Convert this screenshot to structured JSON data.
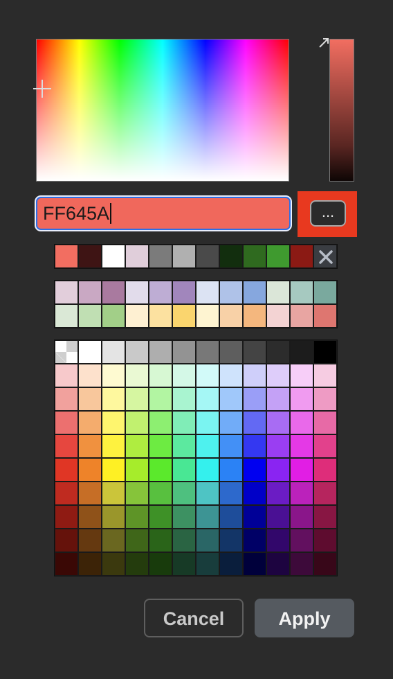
{
  "picker": {
    "hex_value": "FF645A",
    "more_label": "...",
    "selected_color": "#F26E61"
  },
  "recent_colors": [
    "#F26E61",
    "#3E1414",
    "#FFFFFF",
    "#E0CEDA",
    "#7B7B7B",
    "#B0B0B0",
    "#4A4A4A",
    "#122E0E",
    "#2F6A1F",
    "#3F9A2F",
    "#8B1A14",
    "clear"
  ],
  "pastel_rows": [
    [
      "#E2CEDB",
      "#C9A8C3",
      "#A97A9F",
      "#E2DCEB",
      "#BEADD4",
      "#A186BC",
      "#DCE3F3",
      "#AFC2E8",
      "#86A7DE",
      "#DBE6D8",
      "#A6C9C0",
      "#7AA99E"
    ],
    [
      "#DAE8D6",
      "#C0DFB3",
      "#A2CF88",
      "#FEF0D2",
      "#FCE1A0",
      "#FAD56E",
      "#FEF4D1",
      "#F8D1A7",
      "#F4B77E",
      "#F3D3D3",
      "#E8A5A2",
      "#DE7670"
    ]
  ],
  "main_rows": [
    [
      "transparent",
      "#FFFFFF",
      "#E4E4E4",
      "#C9C9C9",
      "#AEAEAE",
      "#939393",
      "#787878",
      "#5E5E5E",
      "#444444",
      "#2C2C2C",
      "#1C1C1C",
      "#000000"
    ],
    [
      "#F7C9CB",
      "#FDE1CC",
      "#FEFAD1",
      "#EAF9D3",
      "#D7F8D3",
      "#D4F8E7",
      "#D2FAF9",
      "#CFE3FC",
      "#CFCFFA",
      "#DECDFA",
      "#F7CEF8",
      "#F6CCE2"
    ],
    [
      "#F1A19D",
      "#F8C79C",
      "#FEF89E",
      "#D6F6A1",
      "#B2F5A2",
      "#A9F4D0",
      "#A5F7F5",
      "#A0C8FA",
      "#9A9EF7",
      "#C4A1F6",
      "#F09BF0",
      "#EE9BC4"
    ],
    [
      "#EC706F",
      "#F4AC6D",
      "#FEF56E",
      "#C1F16F",
      "#8DEF71",
      "#80EDB7",
      "#7AF4F1",
      "#71ACF8",
      "#6369F3",
      "#A86CF3",
      "#E969EA",
      "#E76AA6"
    ],
    [
      "#E6473F",
      "#F0913F",
      "#FEF23F",
      "#AFED40",
      "#6DEB42",
      "#5CE99F",
      "#4EF1EE",
      "#4390F6",
      "#3438F1",
      "#9A3EF2",
      "#E439E6",
      "#E2418C"
    ],
    [
      "#E03625",
      "#EE8329",
      "#FEF024",
      "#A6EC2B",
      "#5BE92C",
      "#49E794",
      "#34F0ED",
      "#2B82F5",
      "#0000F0",
      "#8A24F2",
      "#E11EE4",
      "#DE2D7A"
    ],
    [
      "#BF2B20",
      "#C66E26",
      "#CBC53A",
      "#86C43A",
      "#58C03F",
      "#4EC07F",
      "#4EC4C4",
      "#2D69CC",
      "#0000C8",
      "#6B1CC4",
      "#BB22BB",
      "#B6255E"
    ],
    [
      "#8F1B13",
      "#8F5219",
      "#9A962B",
      "#5E9427",
      "#3E9127",
      "#3D9162",
      "#3D9494",
      "#1E4D9A",
      "#000097",
      "#4A1094",
      "#8A168A",
      "#881643"
    ],
    [
      "#65120B",
      "#653910",
      "#6A6720",
      "#3F6619",
      "#2A6419",
      "#2A6443",
      "#2A6666",
      "#133567",
      "#000066",
      "#32076B",
      "#62105F",
      "#5E0C2F"
    ],
    [
      "#3A0805",
      "#3C2307",
      "#3B390E",
      "#243C0D",
      "#183B0C",
      "#173A26",
      "#183D3C",
      "#0A1E3C",
      "#00003B",
      "#1D0440",
      "#3D0A3A",
      "#380719"
    ]
  ],
  "buttons": {
    "cancel_label": "Cancel",
    "apply_label": "Apply"
  }
}
